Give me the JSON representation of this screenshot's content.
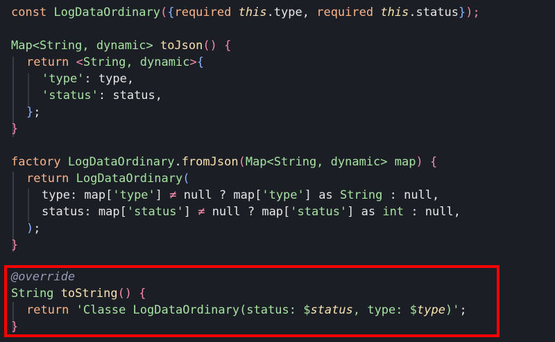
{
  "code": {
    "l1": {
      "const": "const",
      "cls": "LogDataOrdinary",
      "p1": "(",
      "p2": "{",
      "req1": "required",
      "this1": "this",
      "f1": ".type, ",
      "req2": "required",
      "this2": "this",
      "f2": ".status",
      "p3": "}",
      "p4": ");"
    },
    "l3": {
      "map": "Map<String, dynamic>",
      "name": "toJson",
      "paren": "()",
      "brace": "{"
    },
    "l4": {
      "ret": "return",
      "lt": "<",
      "types": "String, dynamic",
      "gt": ">",
      "brace": "{"
    },
    "l5": {
      "key": "'type'",
      "rest": ": type,"
    },
    "l6": {
      "key": "'status'",
      "rest": ": status,"
    },
    "l7": {
      "brace": "}",
      "semi": ";"
    },
    "l8": {
      "brace": "}"
    },
    "l10": {
      "factory": "factory",
      "cls": "LogDataOrdinary",
      "dot": ".",
      "name": "fromJson",
      "p1": "(",
      "params": "Map<String, dynamic> map",
      "p2": ")",
      "brace": "{"
    },
    "l11": {
      "ret": "return",
      "cls": "LogDataOrdinary",
      "paren": "("
    },
    "l12": {
      "a": "type: map[",
      "k1": "'type'",
      "b": "] ",
      "ne": "≠",
      "c": " null ? map[",
      "k2": "'type'",
      "d": "] as ",
      "t": "String",
      "e": " : null,"
    },
    "l13": {
      "a": "status: map[",
      "k1": "'status'",
      "b": "] ",
      "ne": "≠",
      "c": " null ? map[",
      "k2": "'status'",
      "d": "] as ",
      "t": "int",
      "e": " : null,"
    },
    "l14": {
      "paren": ")",
      "semi": ";"
    },
    "l15": {
      "brace": "}"
    },
    "l17": {
      "ann": "@override"
    },
    "l18": {
      "type": "String",
      "name": "toString",
      "paren": "()",
      "brace": "{"
    },
    "l19": {
      "ret": "return",
      "s1": "'Classe LogDataOrdinary(status: ",
      "v1d": "$",
      "v1": "status",
      "s2": ", type: ",
      "v2d": "$",
      "v2": "type",
      "s3": ")'",
      "semi": ";"
    },
    "l20": {
      "brace": "}"
    }
  },
  "colors": {
    "background": "#1c1e26",
    "highlight_border": "#ff0000"
  }
}
